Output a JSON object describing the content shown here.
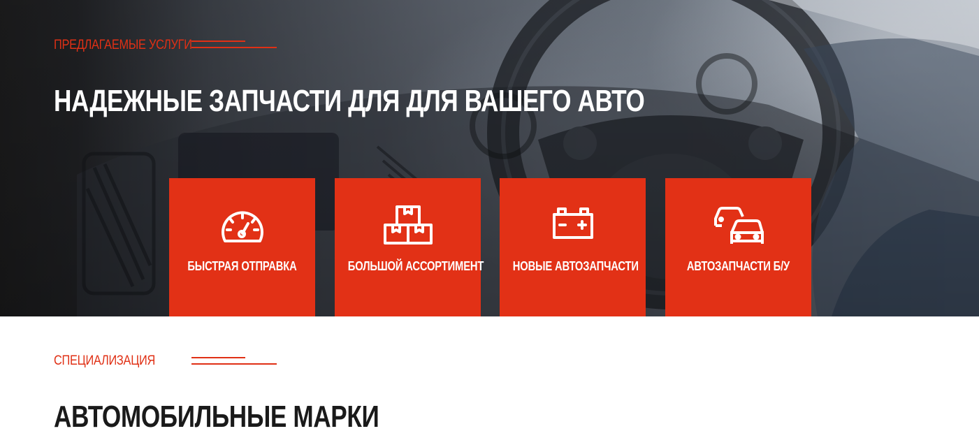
{
  "services": {
    "eyebrow": "ПРЕДЛАГАЕМЫЕ УСЛУГИ",
    "title": "НАДЕЖНЫЕ ЗАПЧАСТИ ДЛЯ ДЛЯ ВАШЕГО АВТО",
    "cards": [
      {
        "label": "БЫСТРАЯ ОТПРАВКА",
        "icon": "speedometer-icon"
      },
      {
        "label": "БОЛЬШОЙ АССОРТИМЕНТ",
        "icon": "boxes-icon"
      },
      {
        "label": "НОВЫЕ АВТОЗАПЧАСТИ",
        "icon": "battery-icon"
      },
      {
        "label": "АВТОЗАПЧАСТИ Б/У",
        "icon": "cars-icon"
      }
    ]
  },
  "specialization": {
    "eyebrow": "СПЕЦИАЛИЗАЦИЯ",
    "title": "АВТОМОБИЛЬНЫЕ МАРКИ"
  },
  "colors": {
    "accent": "#e23116",
    "hero_text": "#ffffff",
    "heading": "#1a1a1a"
  }
}
